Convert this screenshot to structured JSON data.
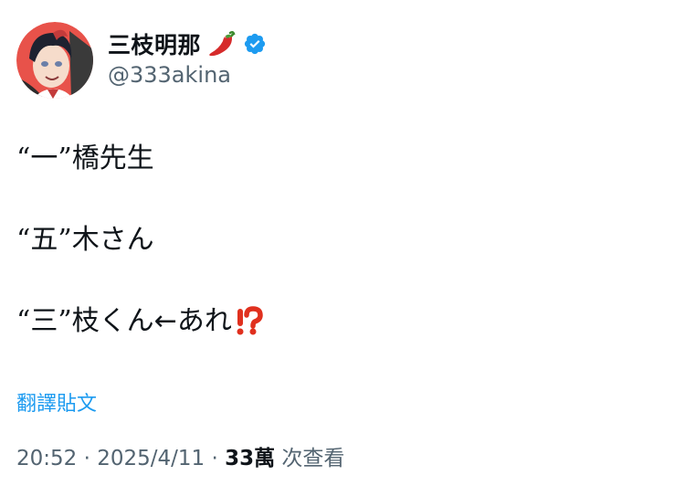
{
  "author": {
    "display_name": "三枝明那",
    "handle": "@333akina",
    "verified": true,
    "name_emoji": "hot-pepper-icon",
    "verified_color": "#1d9bf0"
  },
  "tweet": {
    "lines": [
      {
        "open_quote": "“",
        "quoted": "一",
        "close_quote": "”",
        "rest": "橋先生"
      },
      {
        "open_quote": "“",
        "quoted": "五",
        "close_quote": "”",
        "rest": "木さん"
      },
      {
        "open_quote": "“",
        "quoted": "三",
        "close_quote": "”",
        "rest": "枝くん←あれ"
      }
    ],
    "trailing_emoji": "interrobang-icon"
  },
  "translate_label": "翻譯貼文",
  "meta": {
    "time": "20:52",
    "sep1": " · ",
    "date": "2025/4/11",
    "sep2": " · ",
    "views_count": "33萬",
    "views_label": " 次查看"
  },
  "colors": {
    "link": "#1d9bf0",
    "secondary_text": "#536471",
    "primary_text": "#0f1419"
  }
}
